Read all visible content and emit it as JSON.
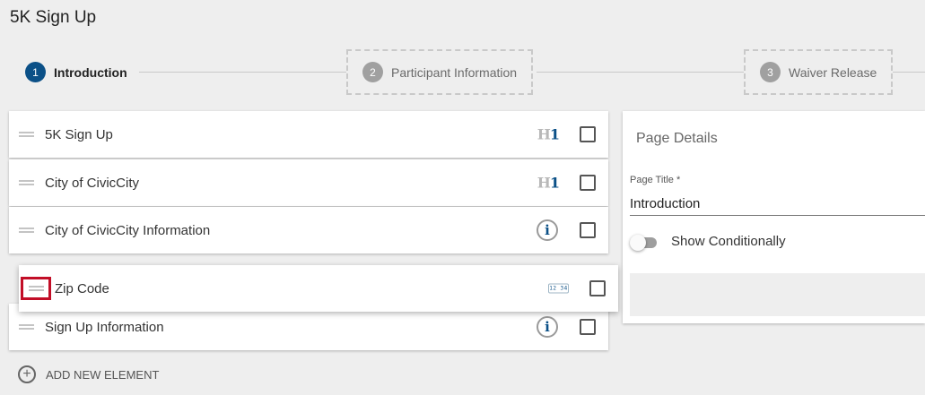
{
  "page": {
    "title": "5K Sign Up"
  },
  "stepper": {
    "steps": [
      {
        "number": "1",
        "label": "Introduction",
        "state": "active"
      },
      {
        "number": "2",
        "label": "Participant Information",
        "state": "inactive"
      },
      {
        "number": "3",
        "label": "Waiver Release",
        "state": "inactive"
      }
    ]
  },
  "elements": [
    {
      "label": "5K Sign Up",
      "type_icon": "heading-h1-icon"
    },
    {
      "label": "City of CivicCity",
      "type_icon": "heading-h1-icon"
    },
    {
      "label": "City of CivicCity Information",
      "type_icon": "info-icon"
    },
    {
      "label": "Zip Code",
      "type_icon": "zip-code-field-icon",
      "state": "dragging"
    },
    {
      "label": "Sign Up Information",
      "type_icon": "info-icon"
    }
  ],
  "icons": {
    "h1_letter": "H",
    "h1_digit": "1",
    "info_glyph": "i",
    "zip_glyph": "12 34",
    "plus_glyph": "+"
  },
  "add_element": {
    "label": "ADD NEW ELEMENT"
  },
  "details": {
    "heading": "Page Details",
    "page_title_label": "Page Title *",
    "page_title_value": "Introduction",
    "show_conditionally_label": "Show Conditionally",
    "show_conditionally_on": false
  },
  "colors": {
    "accent": "#0b5087",
    "highlight": "#c20e27",
    "background": "#eeeeee"
  }
}
